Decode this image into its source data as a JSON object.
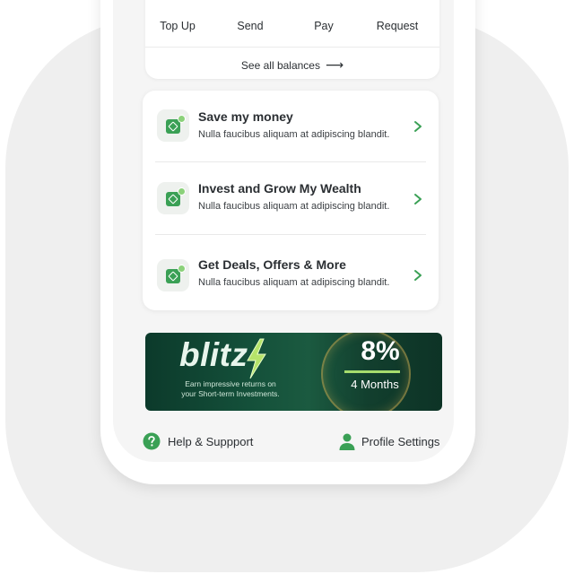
{
  "quick_actions": [
    {
      "label": "Top Up"
    },
    {
      "label": "Send"
    },
    {
      "label": "Pay"
    },
    {
      "label": "Request"
    }
  ],
  "see_all": {
    "label": "See all balances",
    "arrow": "⟶"
  },
  "menu": [
    {
      "title": "Save my money",
      "subtitle": "Nulla faucibus aliquam at adipiscing blandit."
    },
    {
      "title": "Invest and Grow My Wealth",
      "subtitle": "Nulla faucibus aliquam at adipiscing blandit."
    },
    {
      "title": "Get Deals, Offers & More",
      "subtitle": "Nulla faucibus aliquam at adipiscing blandit."
    }
  ],
  "banner": {
    "brand": "blitz",
    "tagline_line1": "Earn impressive returns on",
    "tagline_line2": "your Short-term Investments.",
    "rate": "8%",
    "term": "4 Months"
  },
  "footer": {
    "help": "Help & Suppport",
    "profile": "Profile Settings"
  },
  "colors": {
    "accent_green": "#3aa055",
    "banner_dark": "#0c3a2b",
    "highlight_lime": "#a6dc6d"
  }
}
